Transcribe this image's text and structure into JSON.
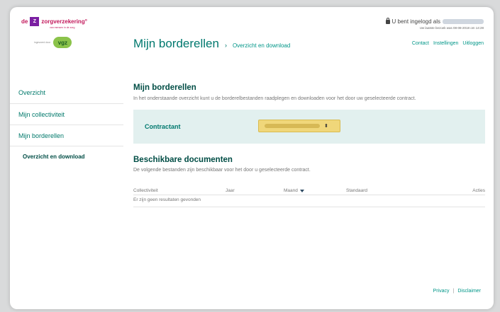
{
  "brand": {
    "logo_prefix": "de",
    "logo_box": "Z",
    "logo_name": "zorgverzekering°",
    "logo_tagline": "van mensen in de zorg",
    "partner_text": "ingevoerd door",
    "partner_logo": "vgz"
  },
  "header": {
    "page_title": "Mijn borderellen",
    "breadcrumb_sep": "›",
    "breadcrumb_current": "Overzicht en download",
    "login_text": "U bent ingelogd als",
    "last_visit": "Uw laatste bezoek was 08-08-2018 om 14:28",
    "links": [
      "Contact",
      "Instellingen",
      "Uitloggen"
    ]
  },
  "sidebar": {
    "items": [
      {
        "label": "Overzicht"
      },
      {
        "label": "Mijn collectiviteit"
      },
      {
        "label": "Mijn borderellen"
      },
      {
        "label": "Overzicht en download"
      }
    ]
  },
  "main": {
    "heading": "Mijn borderellen",
    "intro": "In het onderstaande overzicht kunt u de borderelbestanden raadplegen en downloaden voor het door uw geselecteerde contract.",
    "contract_label": "Contractant",
    "docs_heading": "Beschikbare documenten",
    "docs_intro": "De volgende bestanden zijn beschikbaar voor het door u geselecteerde contract.",
    "table": {
      "columns": [
        "Collectiviteit",
        "Jaar",
        "Maand",
        "Standaard",
        "Acties"
      ],
      "empty": "Er zijn geen resultaten gevonden"
    }
  },
  "footer": {
    "privacy": "Privacy",
    "separator": "|",
    "disclaimer": "Disclaimer"
  },
  "colors": {
    "accent": "#00786e",
    "link": "#009688",
    "contract_bg": "#e2f0ef",
    "select_bg": "#f0d77a"
  }
}
